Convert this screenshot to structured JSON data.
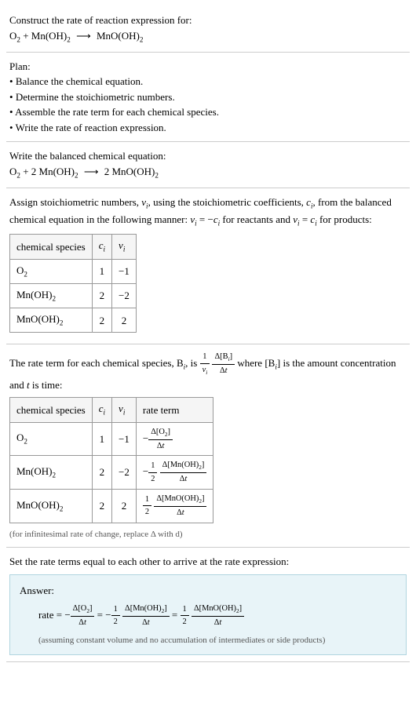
{
  "section1": {
    "title": "Construct the rate of reaction expression for:"
  },
  "section2": {
    "title": "Plan:",
    "items": [
      "Balance the chemical equation.",
      "Determine the stoichiometric numbers.",
      "Assemble the rate term for each chemical species.",
      "Write the rate of reaction expression."
    ]
  },
  "section3": {
    "title": "Write the balanced chemical equation:"
  },
  "section4": {
    "intro1": "Assign stoichiometric numbers, ",
    "intro2": ", using the stoichiometric coefficients, ",
    "intro3": ", from the balanced chemical equation in the following manner: ",
    "intro4": " for reactants and ",
    "intro5": " for products:"
  },
  "table1": {
    "headers": [
      "chemical species"
    ],
    "rows": [
      {
        "c": "1",
        "v": "−1"
      },
      {
        "c": "2",
        "v": "−2"
      },
      {
        "c": "2",
        "v": "2"
      }
    ]
  },
  "section5": {
    "intro1": "The rate term for each chemical species, ",
    "intro2": ", is ",
    "intro3": " where ",
    "intro4": " is the amount concentration and ",
    "intro5": " is time:"
  },
  "table2": {
    "h1": "chemical species",
    "h4": "rate term",
    "rows": [
      {
        "c": "1",
        "v": "−1"
      },
      {
        "c": "2",
        "v": "−2"
      },
      {
        "c": "2",
        "v": "2"
      }
    ]
  },
  "table2note": "(for infinitesimal rate of change, replace Δ with d)",
  "section6": {
    "title": "Set the rate terms equal to each other to arrive at the rate expression:"
  },
  "answer": {
    "label": "Answer:",
    "note": "(assuming constant volume and no accumulation of intermediates or side products)"
  }
}
